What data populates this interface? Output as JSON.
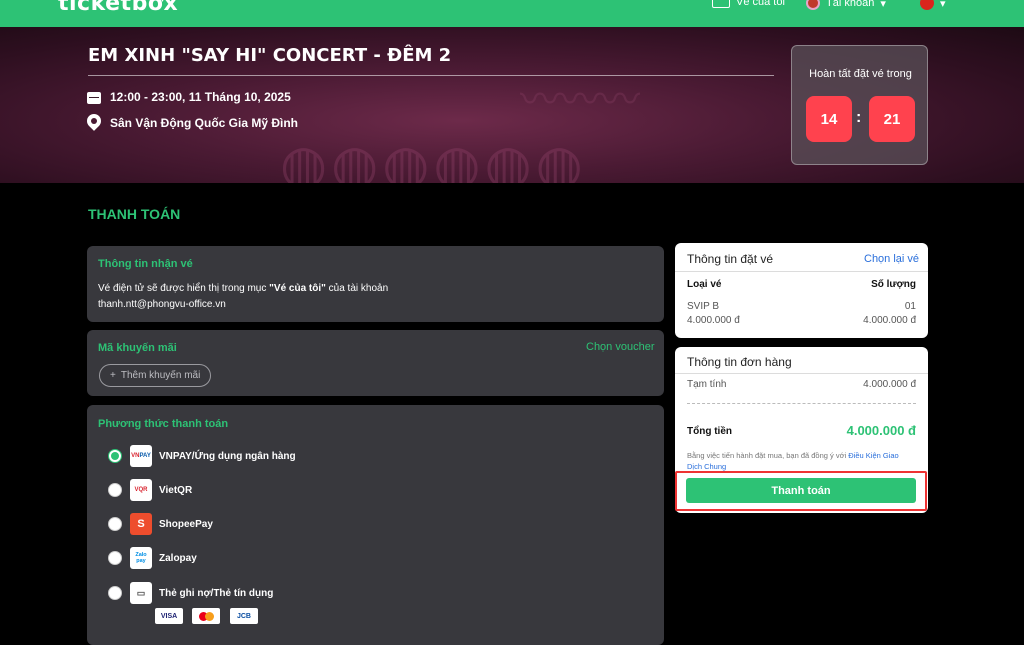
{
  "nav": {
    "logo": "ticketbox",
    "my_tickets": "Vé của tôi",
    "account": "Tài khoản"
  },
  "event": {
    "title": "EM XINH \"SAY HI\" CONCERT - ĐÊM 2",
    "datetime": "12:00 - 23:00, 11 Tháng 10, 2025",
    "venue": "Sân Vận Động Quốc Gia Mỹ Đình"
  },
  "timer": {
    "label": "Hoàn tất đặt vé trong",
    "minutes": "14",
    "seconds": "21",
    "separator": ":"
  },
  "page": {
    "section_title": "THANH TOÁN"
  },
  "recipient": {
    "heading": "Thông tin nhận vé",
    "line1_pre": "Vé điện tử sẽ được hiển thị trong mục ",
    "line1_bold": "\"Vé của tôi\"",
    "line1_post": " của tài khoản",
    "email": "thanh.ntt@phongvu-office.vn"
  },
  "promo": {
    "heading": "Mã khuyến mãi",
    "voucher_link": "Chọn voucher",
    "add_label": "Thêm khuyến mãi"
  },
  "payment": {
    "heading": "Phương thức thanh toán",
    "methods": [
      {
        "label": "VNPAY/Ứng dụng ngân hàng",
        "selected": true
      },
      {
        "label": "VietQR",
        "selected": false
      },
      {
        "label": "ShopeePay",
        "selected": false
      },
      {
        "label": "Zalopay",
        "selected": false
      },
      {
        "label": "Thẻ ghi nợ/Thẻ tín dụng",
        "selected": false
      }
    ],
    "card_brands": [
      "VISA",
      "Mastercard",
      "JCB"
    ]
  },
  "booking": {
    "title": "Thông tin đặt vé",
    "reselect": "Chọn lại vé",
    "col_type": "Loại vé",
    "col_qty": "Số lượng",
    "ticket_name": "SVIP B",
    "ticket_qty": "01",
    "ticket_price": "4.000.000 đ",
    "ticket_subtotal": "4.000.000 đ"
  },
  "order": {
    "title": "Thông tin đơn hàng",
    "subtotal_label": "Tạm tính",
    "subtotal_value": "4.000.000 đ",
    "total_label": "Tổng tiền",
    "total_value": "4.000.000 đ",
    "terms_pre": "Bằng việc tiến hành đặt mua, bạn đã đồng ý với ",
    "terms_link": "Điều Kiện Giao Dịch Chung",
    "pay_button": "Thanh toán"
  },
  "colors": {
    "brand_green": "#2dc275",
    "timer_red": "#ff424e",
    "highlight_red": "#e33333"
  }
}
